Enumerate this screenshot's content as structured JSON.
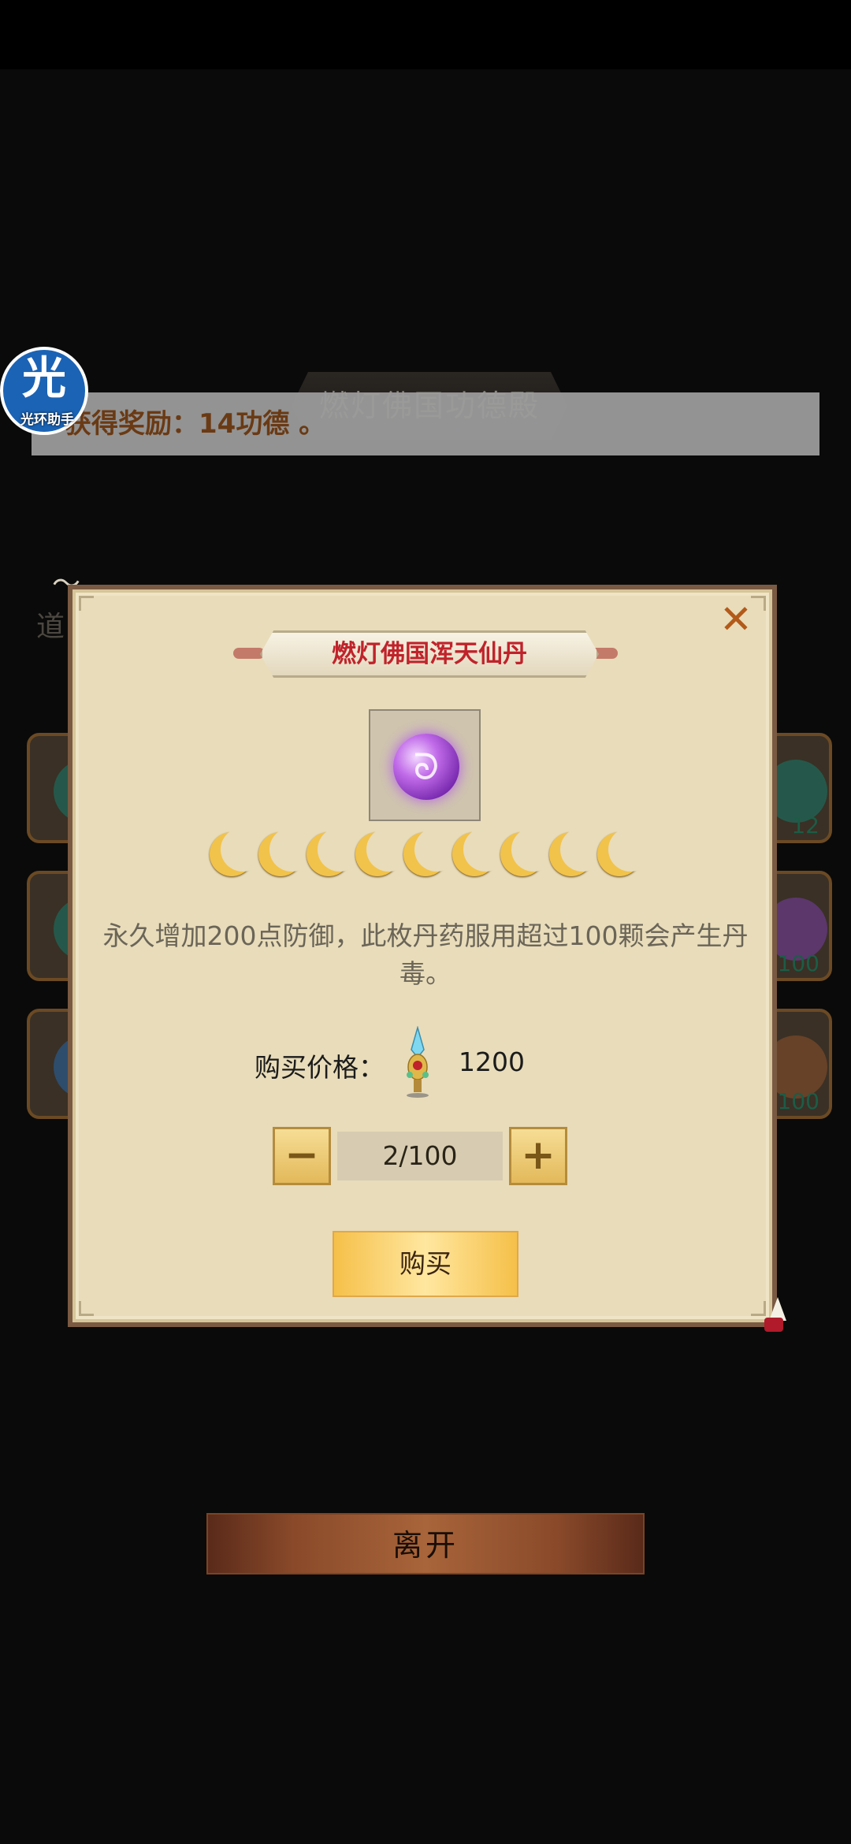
{
  "background": {
    "screen_title": "燃灯佛国功德殿",
    "reward_message": "获得奖励：14功德 。",
    "assistant_badge": {
      "glyph": "光",
      "label": "光环助手"
    },
    "side_label": "道",
    "card_counts": [
      "12",
      "100",
      "100"
    ],
    "leave_label": "离开"
  },
  "dialog": {
    "title": "燃灯佛国浑天仙丹",
    "close_glyph": "✕",
    "item_icon": "purple-orb-pill-icon",
    "moon_count": 9,
    "description": "永久增加200点防御，此枚丹药服用超过100颗会产生丹毒。",
    "price_label": "购买价格：",
    "price_value": "1200",
    "price_currency_icon": "jade-crystal-icon",
    "decrement_glyph": "−",
    "increment_glyph": "+",
    "quantity": "2/100",
    "buy_label": "购买"
  },
  "colors": {
    "dialog_bg": "#e8dcba",
    "title_red": "#c0232b",
    "close_orange": "#b35a1a",
    "moon_gold": "#f2c34a",
    "buy_gold": "#f5c049"
  }
}
